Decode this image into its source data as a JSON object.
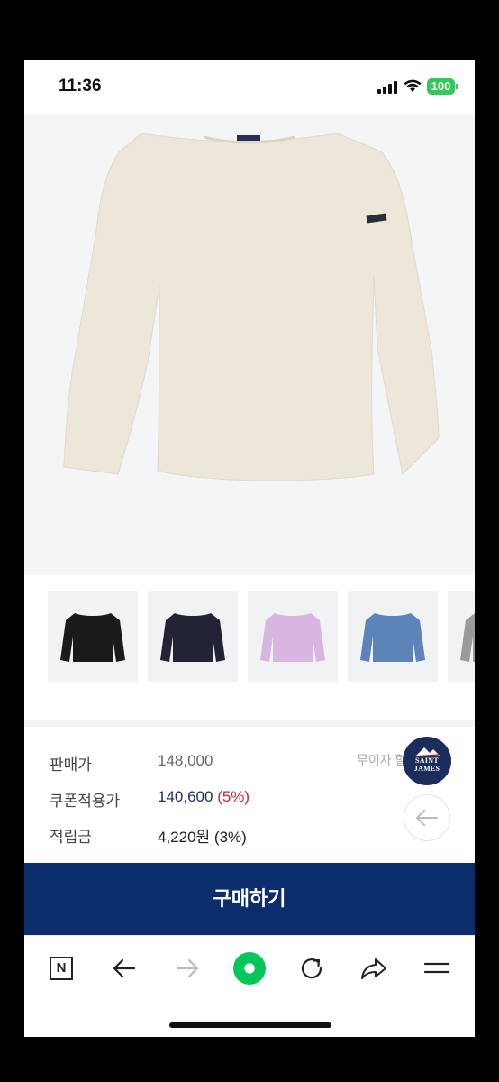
{
  "status_bar": {
    "time": "11:36",
    "battery": "100"
  },
  "gallery": {
    "slide_count": 6,
    "active_slide": 1
  },
  "color_options": [
    {
      "color": "#1a1a1c"
    },
    {
      "color": "#232336"
    },
    {
      "color": "#d9b6e2"
    },
    {
      "color": "#5d84b8"
    },
    {
      "color": "#9a9a9c"
    }
  ],
  "pricing": {
    "sale_label": "판매가",
    "sale_price": "148,000",
    "coupon_label": "쿠폰적용가",
    "coupon_price": "140,600",
    "coupon_discount": "(5%)",
    "points_label": "적립금",
    "points_value": "4,220원 (3%)",
    "installment_note": "무이자 할"
  },
  "brand": {
    "logo_text": "SAINT JAMES"
  },
  "buy_button": {
    "label": "구매하기"
  },
  "browser_toolbar": {
    "home_label": "N"
  },
  "colors": {
    "accent": "#0b2d6b",
    "discount": "#c0283c",
    "browser_green": "#03c75a"
  }
}
